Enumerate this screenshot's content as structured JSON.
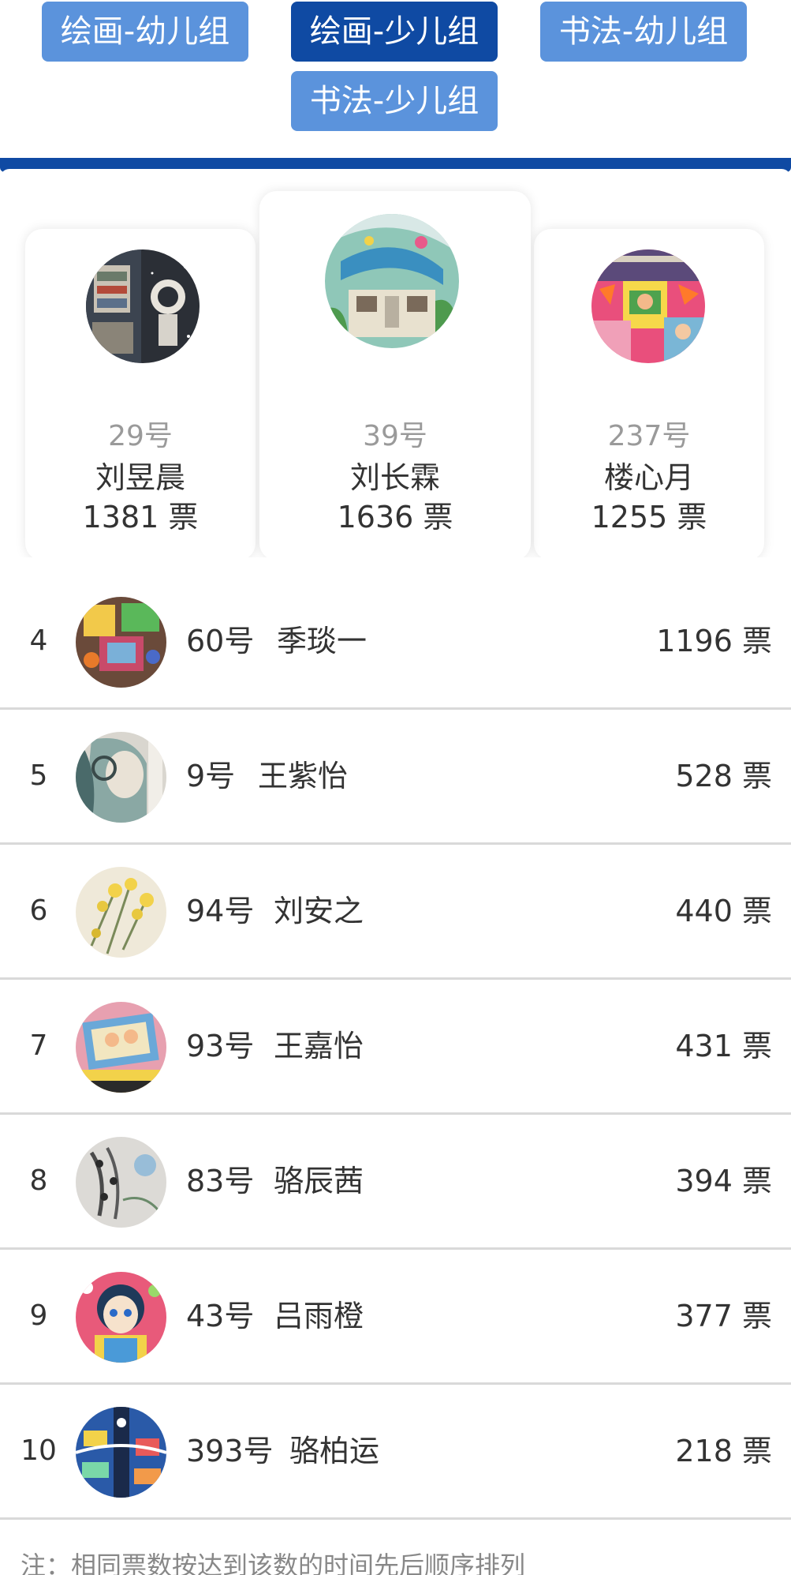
{
  "tabs": [
    {
      "label": "绘画-幼儿组",
      "active": false
    },
    {
      "label": "绘画-少儿组",
      "active": true
    },
    {
      "label": "书法-幼儿组",
      "active": false
    },
    {
      "label": "书法-少儿组",
      "active": false
    }
  ],
  "podium": [
    {
      "no": "29号",
      "name": "刘昱晨",
      "votes": "1381 票"
    },
    {
      "no": "39号",
      "name": "刘长霖",
      "votes": "1636 票"
    },
    {
      "no": "237号",
      "name": "楼心月",
      "votes": "1255 票"
    }
  ],
  "ranking": [
    {
      "rank": "4",
      "no": "60号",
      "name": "季琰一",
      "votes": "1196 票"
    },
    {
      "rank": "5",
      "no": "9号",
      "name": "王紫怡",
      "votes": "528 票"
    },
    {
      "rank": "6",
      "no": "94号",
      "name": "刘安之",
      "votes": "440 票"
    },
    {
      "rank": "7",
      "no": "93号",
      "name": "王嘉怡",
      "votes": "431 票"
    },
    {
      "rank": "8",
      "no": "83号",
      "name": "骆辰茜",
      "votes": "394 票"
    },
    {
      "rank": "9",
      "no": "43号",
      "name": "吕雨橙",
      "votes": "377 票"
    },
    {
      "rank": "10",
      "no": "393号",
      "name": "骆柏运",
      "votes": "218 票"
    }
  ],
  "note": "注：相同票数按达到该数的时间先后顺序排列",
  "colors": {
    "accent": "#0f4aa3",
    "tab": "#5b93dc"
  }
}
